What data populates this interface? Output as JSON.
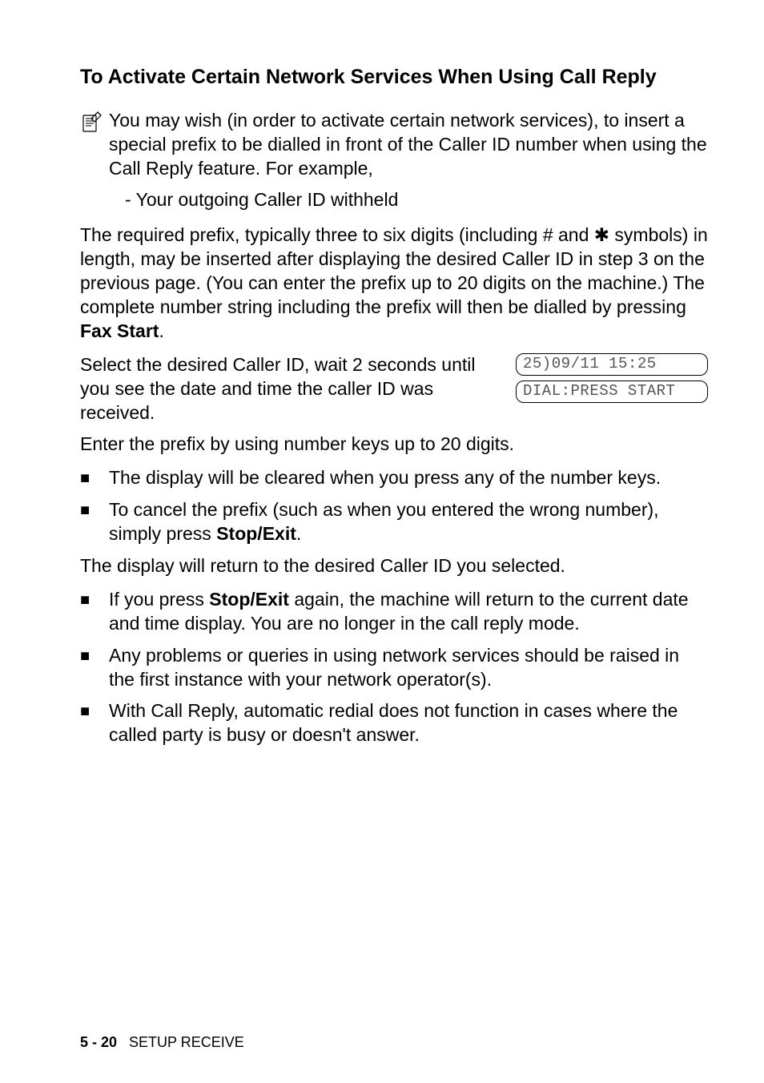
{
  "heading": "To Activate Certain Network Services When Using Call Reply",
  "note": "You may wish (in order to activate certain network services), to insert a special prefix to be dialled in front of the Caller ID number when using the Call Reply feature. For example,",
  "note_sub": "- Your outgoing Caller ID withheld",
  "para1_a": "The required prefix, typically three to six digits (including # and ",
  "para1_b": " symbols) in length, may be inserted after displaying the desired Caller ID in step 3 on the previous page. (You can enter the prefix up to 20 digits on the machine.) The complete number string including the prefix will then be dialled by pressing ",
  "para1_bold": "Fax Start",
  "para1_c": ".",
  "row_text": "Select the desired Caller ID, wait 2 seconds until you see the date and time the caller ID was received.",
  "lcd1": "25)09/11 15:25",
  "lcd2": "DIAL:PRESS START",
  "para2": "Enter the prefix by using number keys up to 20 digits.",
  "list1_item1": "The display will be cleared when you press any of the number keys.",
  "list1_item2_a": "To cancel the prefix (such as when you entered the wrong number), simply press ",
  "list1_item2_bold": "Stop/Exit",
  "list1_item2_b": ".",
  "para3": "The display will return to the desired Caller ID you selected.",
  "list2_item1_a": "If you press ",
  "list2_item1_bold": "Stop/Exit",
  "list2_item1_b": " again, the machine will return to the current date and time display. You are no longer in the call reply mode.",
  "list2_item2": "Any problems or queries in using network services should be raised in the first instance with your network operator(s).",
  "list2_item3": "With Call Reply, automatic redial does not function in cases where the called party is busy or doesn't answer.",
  "footer_page": "5 - 20",
  "footer_label": "SETUP RECEIVE"
}
